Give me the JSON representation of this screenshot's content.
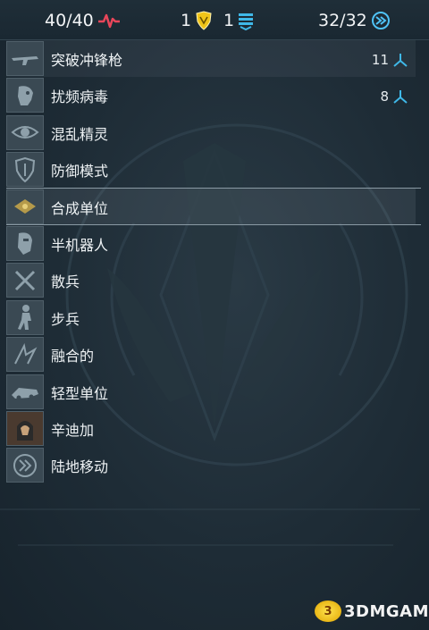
{
  "top_bar": {
    "health": "40/40",
    "armor": "1",
    "shield": "1",
    "energy": "32/32"
  },
  "list_items": [
    {
      "label": "突破冲锋枪",
      "count": "11",
      "icon": "smg-icon",
      "unit_icon": "unit-icon"
    },
    {
      "label": "扰频病毒",
      "count": "8",
      "icon": "virus-head-icon",
      "unit_icon": "unit-icon"
    },
    {
      "label": "混乱精灵",
      "icon": "eye-icon"
    },
    {
      "label": "防御模式",
      "icon": "shield-icon"
    },
    {
      "label": "合成单位",
      "icon": "synthetic-icon"
    },
    {
      "label": "半机器人",
      "icon": "cyborg-head-icon"
    },
    {
      "label": "散兵",
      "icon": "crossed-blades-icon"
    },
    {
      "label": "步兵",
      "icon": "soldier-icon"
    },
    {
      "label": "融合的",
      "icon": "fusion-icon"
    },
    {
      "label": "轻型单位",
      "icon": "light-unit-icon"
    },
    {
      "label": "辛迪加",
      "icon": "syndicate-icon"
    },
    {
      "label": "陆地移动",
      "icon": "ground-move-icon"
    }
  ],
  "watermark": {
    "text": "3DMGAME",
    "badge": "3"
  },
  "colors": {
    "health": "#e8465a",
    "armor": "#f0c419",
    "shield": "#3fb8e8",
    "energy": "#4fc3f7",
    "unit": "#3fb8e8"
  }
}
